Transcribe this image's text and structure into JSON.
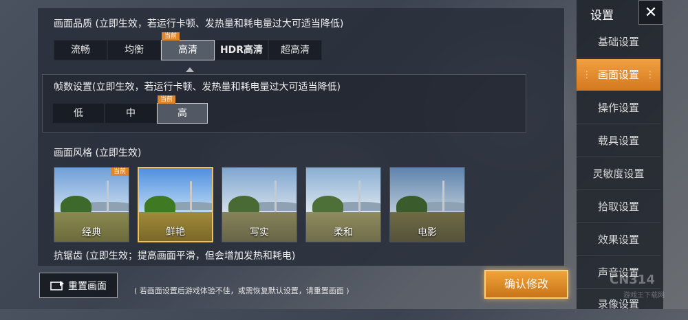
{
  "quality": {
    "title": "画面品质 (立即生效，若运行卡顿、发热量和耗电量过大可适当降低)",
    "options": [
      "流畅",
      "均衡",
      "高清",
      "HDR高清",
      "超高清"
    ],
    "current_tag": "当前"
  },
  "fps": {
    "title": "帧数设置(立即生效，若运行卡顿、发热量和耗电量过大可适当降低)",
    "options": [
      "低",
      "中",
      "高"
    ],
    "current_tag": "当前"
  },
  "style": {
    "title": "画面风格 (立即生效)",
    "options": [
      "经典",
      "鲜艳",
      "写实",
      "柔和",
      "电影"
    ],
    "current_tag": "当前"
  },
  "antialias": {
    "title": "抗锯齿 (立即生效；提高画面平滑，但会增加发热和耗电)"
  },
  "sidebar": {
    "title": "设置",
    "items": [
      "基础设置",
      "画面设置",
      "操作设置",
      "载具设置",
      "灵敏度设置",
      "拾取设置",
      "效果设置",
      "声音设置",
      "录像设置"
    ]
  },
  "footer": {
    "reset_label": "重置画面",
    "note": "( 若画面设置后游戏体验不佳，或需恢复默认设置，请重置画面 )",
    "confirm_label": "确认修改"
  },
  "watermark": {
    "text": "CN314",
    "sub": "游戏王下载网"
  },
  "colors": {
    "accent": "#e0862a",
    "selected_border": "#f0c060"
  }
}
